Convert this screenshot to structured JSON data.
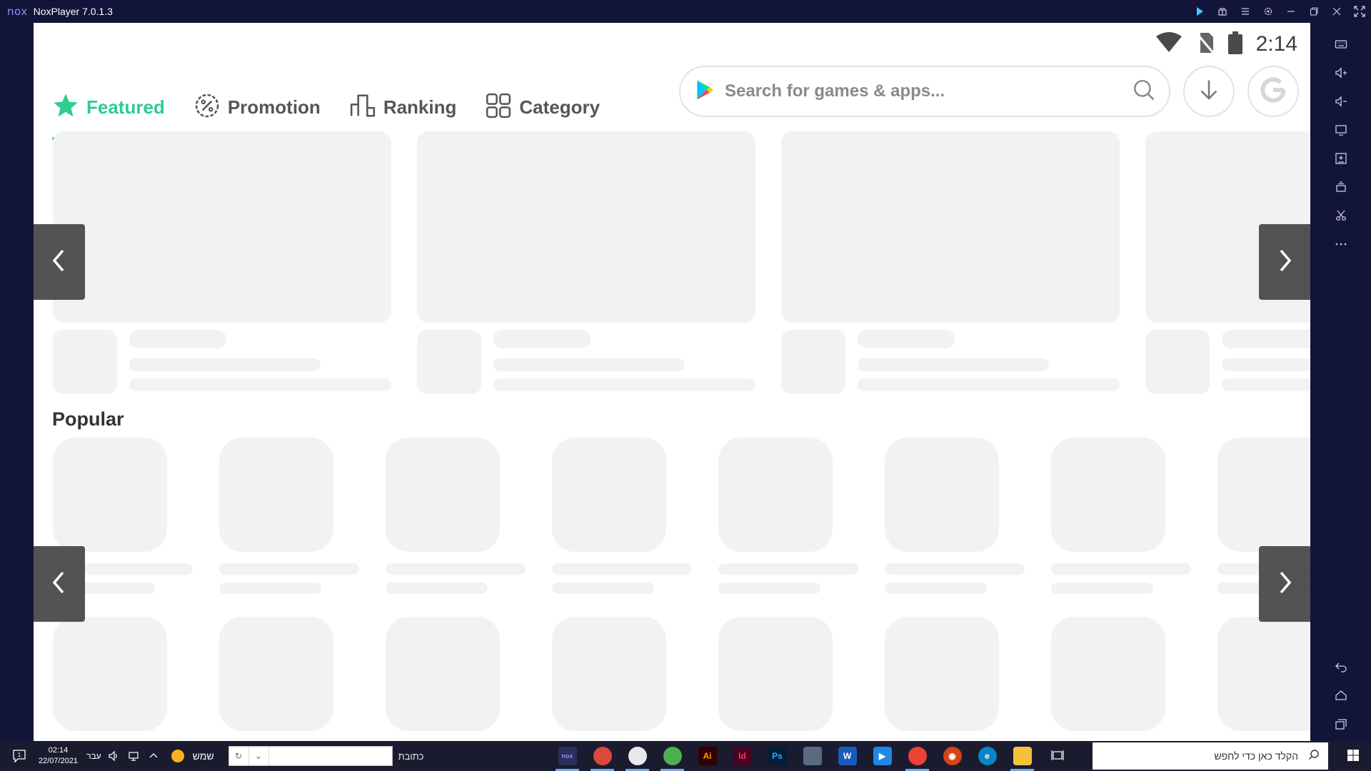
{
  "window": {
    "logo": "nox",
    "title": "NoxPlayer 7.0.1.3",
    "controls": [
      "play-icon",
      "gift-icon",
      "menu-icon",
      "settings-icon",
      "minimize-icon",
      "restore-icon",
      "close-icon",
      "fullscreen-icon"
    ]
  },
  "status_bar": {
    "time": "2:14"
  },
  "tabs": [
    {
      "label": "Featured",
      "icon": "star-icon",
      "active": true
    },
    {
      "label": "Promotion",
      "icon": "percent-badge-icon",
      "active": false
    },
    {
      "label": "Ranking",
      "icon": "ranking-bars-icon",
      "active": false
    },
    {
      "label": "Category",
      "icon": "grid-icon",
      "active": false
    }
  ],
  "search": {
    "placeholder": "Search for games & apps..."
  },
  "popular": {
    "title": "Popular"
  },
  "sidebar_tools": [
    "keyboard-icon",
    "volume-up-icon",
    "volume-down-icon",
    "screen-icon",
    "add-apk-icon",
    "multi-instance-icon",
    "scissors-icon",
    "more-icon"
  ],
  "sidebar_nav": [
    "back-icon",
    "home-icon",
    "recent-apps-icon"
  ],
  "taskbar": {
    "notification_count": "1",
    "clock_time": "02:14",
    "clock_date": "22/07/2021",
    "language": "עבר",
    "weather_label": "שמש",
    "address_label": "כתובת",
    "search_placeholder": "הקלד כאן כדי לחפש",
    "apps": [
      {
        "name": "nox",
        "label": "nox",
        "color": "#2b2f5e",
        "fg": "#8b8ff0",
        "open": true
      },
      {
        "name": "chrome-profile-1",
        "label": "",
        "color": "#d94a3d",
        "fg": "#fff",
        "open": true
      },
      {
        "name": "chrome-profile-2",
        "label": "",
        "color": "#e9e9e9",
        "fg": "#333",
        "open": true
      },
      {
        "name": "chrome-canary",
        "label": "",
        "color": "#4caf50",
        "fg": "#fff",
        "open": true
      },
      {
        "name": "illustrator",
        "label": "Ai",
        "color": "#330000",
        "fg": "#ff9a00",
        "open": false
      },
      {
        "name": "indesign",
        "label": "Id",
        "color": "#49021f",
        "fg": "#ff3366",
        "open": false
      },
      {
        "name": "photoshop",
        "label": "Ps",
        "color": "#001e36",
        "fg": "#31a8ff",
        "open": false
      },
      {
        "name": "calculator",
        "label": "",
        "color": "#5b6b7f",
        "fg": "#fff",
        "open": false
      },
      {
        "name": "word",
        "label": "W",
        "color": "#185abd",
        "fg": "#fff",
        "open": false
      },
      {
        "name": "media-player",
        "label": "▶",
        "color": "#1e88e5",
        "fg": "#fff",
        "open": false
      },
      {
        "name": "chrome",
        "label": "",
        "color": "#ea4335",
        "fg": "#fff",
        "open": true
      },
      {
        "name": "music",
        "label": "◉",
        "color": "#d84315",
        "fg": "#fff",
        "open": false
      },
      {
        "name": "edge",
        "label": "e",
        "color": "#0a84c8",
        "fg": "#fff",
        "open": false
      },
      {
        "name": "file-explorer",
        "label": "",
        "color": "#f3c13a",
        "fg": "#fff",
        "open": true
      },
      {
        "name": "task-view",
        "label": "",
        "color": "transparent",
        "fg": "#fff",
        "open": false
      }
    ]
  },
  "colors": {
    "accent": "#2ecc8f",
    "placeholder": "#f1f2f4",
    "chrome": "#12143a"
  }
}
